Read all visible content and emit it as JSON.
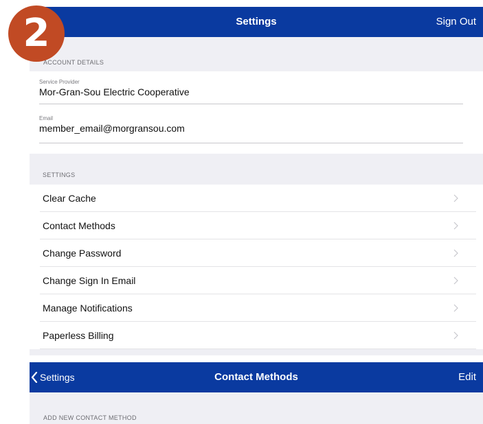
{
  "badge": {
    "number": "2"
  },
  "screen1": {
    "nav": {
      "title": "Settings",
      "right_label": "Sign Out"
    },
    "account": {
      "header": "ACCOUNT DETAILS",
      "fields": [
        {
          "label": "Service Provider",
          "value": "Mor-Gran-Sou Electric Cooperative"
        },
        {
          "label": "Email",
          "value": "member_email@morgransou.com"
        }
      ]
    },
    "settings": {
      "header": "SETTINGS",
      "items": [
        {
          "label": "Clear Cache"
        },
        {
          "label": "Contact Methods"
        },
        {
          "label": "Change Password"
        },
        {
          "label": "Change Sign In Email"
        },
        {
          "label": "Manage Notifications"
        },
        {
          "label": "Paperless Billing"
        }
      ]
    }
  },
  "screen2": {
    "nav": {
      "back_label": "Settings",
      "title": "Contact Methods",
      "right_label": "Edit"
    },
    "section_header": "ADD NEW CONTACT METHOD"
  },
  "colors": {
    "navbar": "#0a3aa0",
    "badge": "#c14a24",
    "background": "#efeff4"
  }
}
